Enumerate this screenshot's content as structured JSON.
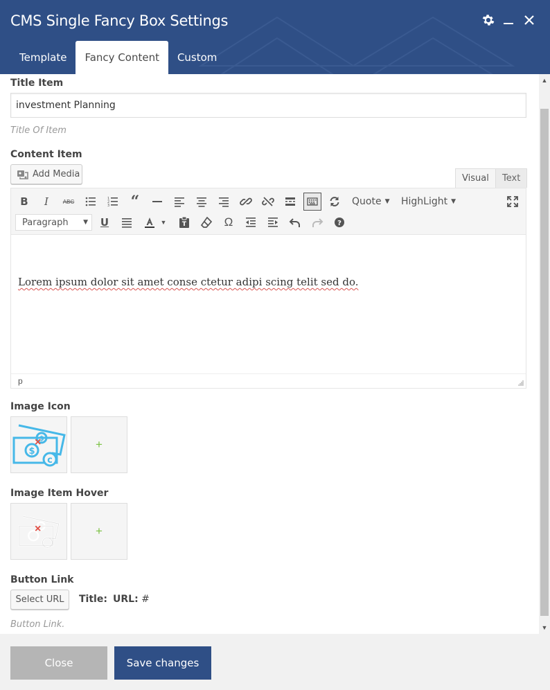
{
  "dialog": {
    "title": "CMS Single Fancy Box Settings",
    "tabs": [
      {
        "label": "Template"
      },
      {
        "label": "Fancy Content"
      },
      {
        "label": "Custom"
      }
    ],
    "active_tab": "Fancy Content",
    "header_icons": [
      "gear-icon",
      "minimize-icon",
      "close-icon"
    ]
  },
  "fields": {
    "title_item": {
      "label": "Title Item",
      "value": "investment Planning",
      "help": "Title Of Item"
    },
    "content_item": {
      "label": "Content Item",
      "add_media_label": "Add Media",
      "mode_tabs": [
        "Visual",
        "Text"
      ],
      "active_mode": "Visual",
      "toolbar": {
        "row1": [
          "bold-icon",
          "italic-icon",
          "strikethrough-icon",
          "bullet-list-icon",
          "numbered-list-icon",
          "blockquote-icon",
          "horizontal-line-icon",
          "align-left-icon",
          "align-center-icon",
          "align-right-icon",
          "link-icon",
          "unlink-icon",
          "read-more-icon",
          "toolbar-toggle-icon",
          "refresh-icon"
        ],
        "quote_label": "Quote",
        "highlight_label": "HighLight",
        "format_select": "Paragraph",
        "row2": [
          "underline-icon",
          "justify-icon",
          "text-color-icon",
          "paste-text-icon",
          "clear-format-icon",
          "special-char-icon",
          "outdent-icon",
          "indent-icon",
          "undo-icon",
          "redo-icon",
          "help-icon"
        ]
      },
      "body_text": "Lorem ipsum dolor sit amet conse ctetur adipi scing telit sed do.",
      "status_path": "p"
    },
    "image_icon": {
      "label": "Image Icon",
      "add_symbol": "+"
    },
    "image_item_hover": {
      "label": "Image Item Hover",
      "add_symbol": "+"
    },
    "button_link": {
      "label": "Button Link",
      "select_url_label": "Select URL",
      "title_label": "Title:",
      "title_value": "",
      "url_label": "URL:",
      "url_value": "#",
      "help": "Button Link."
    }
  },
  "footer": {
    "close_label": "Close",
    "save_label": "Save changes"
  },
  "colors": {
    "header_bg": "#2f4f86",
    "save_bg": "#2f4f86",
    "close_bg": "#b5b5b5",
    "icon_blue": "#46b8e8",
    "add_green": "#7ac142",
    "remove_red": "#e14d43"
  }
}
